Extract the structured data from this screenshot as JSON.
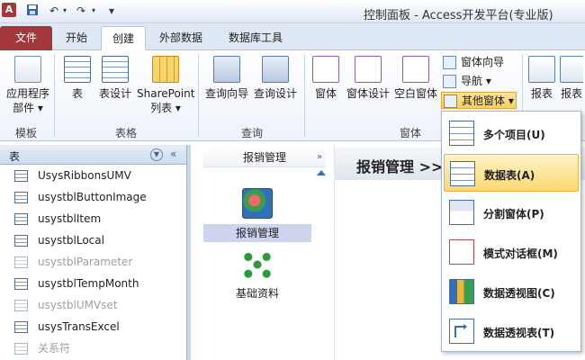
{
  "titlebar": {
    "app_letter": "A",
    "quick_access": [
      "save-icon",
      "undo-icon",
      "redo-icon",
      "customize-icon"
    ],
    "title": "控制面板 - Access开发平台(专业版)"
  },
  "tabs": {
    "file": "文件",
    "items": [
      "开始",
      "创建",
      "外部数据",
      "数据库工具"
    ],
    "active": "创建"
  },
  "ribbon": {
    "groups": {
      "templates": "模板",
      "tables": "表格",
      "queries": "查询",
      "forms": "窗体"
    },
    "buttons": {
      "app_parts_line1": "应用程序",
      "app_parts_line2": "部件 ▾",
      "table": "表",
      "table_design": "表设计",
      "sharepoint_line1": "SharePoint",
      "sharepoint_line2": "列表 ▾",
      "query_wizard": "查询向导",
      "query_design": "查询设计",
      "form": "窗体",
      "form_design": "窗体设计",
      "blank_form": "空白窗体",
      "form_wizard": "窗体向导",
      "navigation": "导航 ▾",
      "more_forms": "其他窗体 ▾",
      "report": "报表",
      "report2": "报表"
    }
  },
  "navpane": {
    "header": "表",
    "items": [
      {
        "label": "UsysRibbonsUMV",
        "dim": false
      },
      {
        "label": "usystblButtonImage",
        "dim": false
      },
      {
        "label": "usystblItem",
        "dim": false
      },
      {
        "label": "usystblLocal",
        "dim": false
      },
      {
        "label": "usystblParameter",
        "dim": true
      },
      {
        "label": "usystblTempMonth",
        "dim": false
      },
      {
        "label": "usystblUMVset",
        "dim": true
      },
      {
        "label": "usysTransExcel",
        "dim": false
      },
      {
        "label": "关系符",
        "dim": true
      }
    ]
  },
  "switchboard": {
    "left_header": "报销管理",
    "items": [
      {
        "label": "报销管理",
        "selected": true
      },
      {
        "label": "基础资料",
        "selected": false
      }
    ],
    "right_title": "报销管理 >>"
  },
  "dropdown_menu": {
    "items": [
      {
        "label": "多个项目(U)",
        "highlighted": false,
        "icon": "multiple-items-icon"
      },
      {
        "label": "数据表(A)",
        "highlighted": true,
        "icon": "datasheet-icon"
      },
      {
        "label": "分割窗体(P)",
        "highlighted": false,
        "icon": "split-form-icon"
      },
      {
        "label": "模式对话框(M)",
        "highlighted": false,
        "icon": "modal-dialog-icon"
      },
      {
        "label": "数据透视图(C)",
        "highlighted": false,
        "icon": "pivot-chart-icon"
      },
      {
        "label": "数据透视表(T)",
        "highlighted": false,
        "icon": "pivot-table-icon"
      }
    ]
  },
  "colors": {
    "file_tab": "#a4373a",
    "highlight": "#fbd871",
    "selection": "#ccd4ee"
  }
}
